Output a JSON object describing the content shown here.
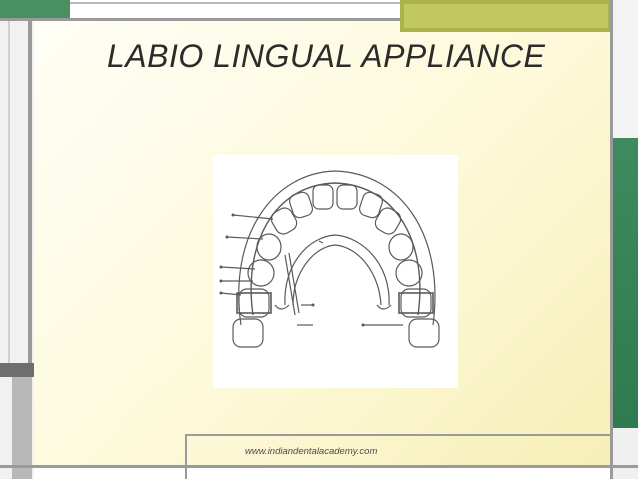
{
  "slide": {
    "title": "LABIO LINGUAL APPLIANCE",
    "footer_url": "www.indiandentalacademy.com"
  },
  "colors": {
    "background_cream": "#fdf9d9",
    "frame_gray": "#8a8a8a",
    "accent_green": "#3f8a5e",
    "accent_olive": "#a8b24a",
    "title_text": "#2b2b2b"
  },
  "figure": {
    "image_semantic": "labio-lingual-appliance-diagram"
  }
}
